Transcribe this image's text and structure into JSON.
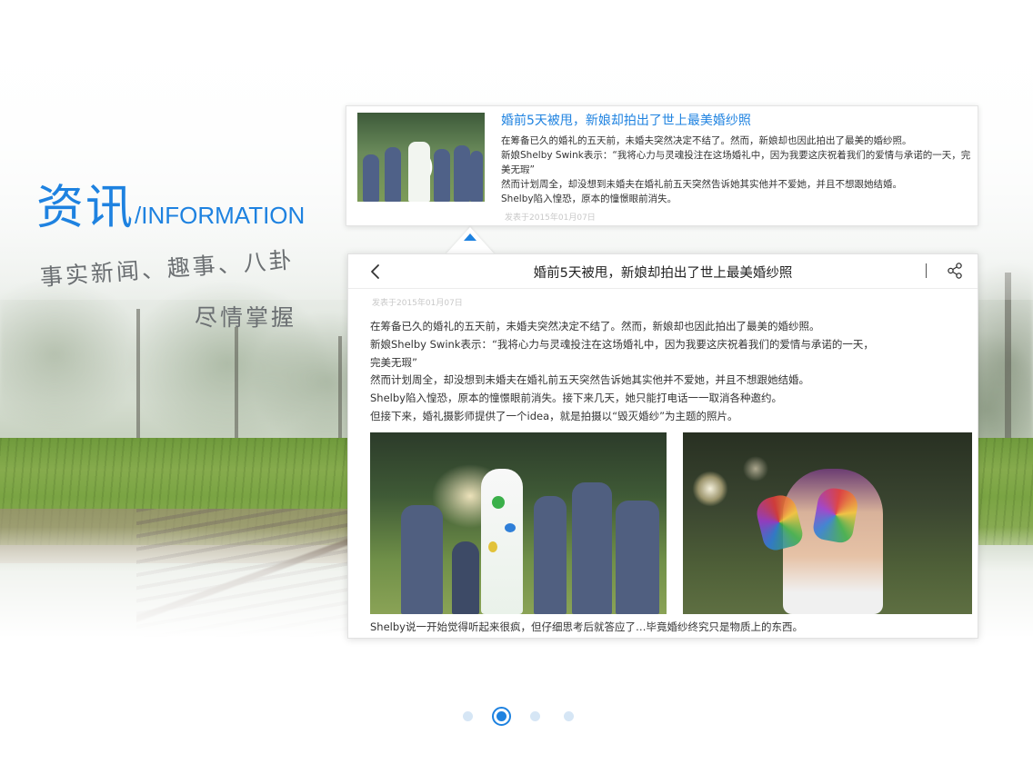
{
  "headline": {
    "title_cn": "资讯",
    "title_en": "/INFORMATION",
    "tagline_line1": "事实新闻、趣事、八卦",
    "tagline_line2": "尽情掌握"
  },
  "list_card": {
    "title": "婚前5天被甩，新娘却拍出了世上最美婚纱照",
    "lines": [
      "在筹备已久的婚礼的五天前，未婚夫突然决定不结了。然而，新娘却也因此拍出了最美的婚纱照。",
      "新娘Shelby Swink表示：“我将心力与灵魂投注在这场婚礼中，因为我要这庆祝着我们的爱情与承诺的一天，完美无瑕”",
      "然而计划周全，却没想到未婚夫在婚礼前五天突然告诉她其实他并不爱她，并且不想跟她结婚。",
      "Shelby陷入惶恐，原本的憧憬眼前消失。"
    ],
    "date": "发表于2015年01月07日"
  },
  "detail_card": {
    "nav_title": "婚前5天被甩，新娘却拍出了世上最美婚纱照",
    "back_icon": "chevron-left-icon",
    "share_icon": "share-icon",
    "date": "发表于2015年01月07日",
    "paragraphs": [
      "在筹备已久的婚礼的五天前，未婚夫突然决定不结了。然而，新娘却也因此拍出了最美的婚纱照。",
      "新娘Shelby Swink表示：“我将心力与灵魂投注在这场婚礼中，因为我要这庆祝着我们的爱情与承诺的一天，",
      "完美无瑕”",
      "然而计划周全，却没想到未婚夫在婚礼前五天突然告诉她其实他并不爱她，并且不想跟她结婚。",
      "Shelby陷入惶恐，原本的憧憬眼前消失。接下来几天，她只能打电话一一取消各种邀约。",
      "但接下来，婚礼摄影师提供了一个idea，就是拍摄以“毁灭婚纱”为主题的照片。"
    ],
    "caption": "Shelby说一开始觉得听起来很疯，但仔细思考后就答应了…毕竟婚纱终究只是物质上的东西。"
  },
  "pager": {
    "total": 4,
    "active_index": 1
  },
  "colors": {
    "accent": "#1e82e0",
    "tagline": "#6b6f72",
    "body_text": "#333333"
  }
}
